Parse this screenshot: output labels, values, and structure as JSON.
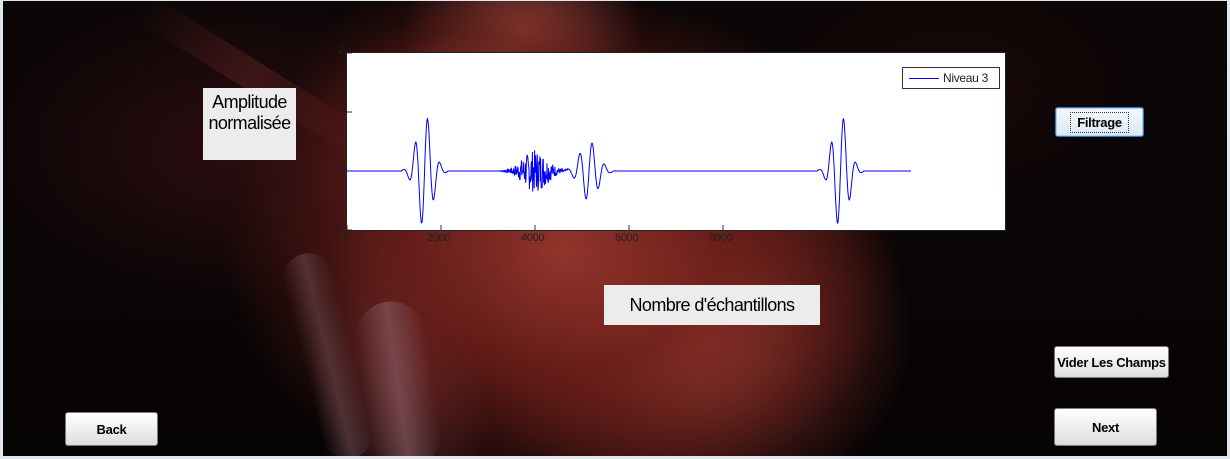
{
  "buttons": {
    "filtrage": "Filtrage",
    "vider": "Vider Les Champs",
    "next": "Next",
    "back": "Back"
  },
  "labels": {
    "ylabel_line1": "Amplitude",
    "ylabel_line2": "normalisée",
    "xlabel": "Nombre d'échantillons"
  },
  "chart_data": {
    "type": "line",
    "xlabel": "Nombre d'échantillons",
    "ylabel": "Amplitude normalisée",
    "xlim": [
      0,
      14000
    ],
    "ylim": [
      -1,
      2
    ],
    "xticks": [
      0,
      2000,
      4000,
      6000,
      8000
    ],
    "yticks": [
      -1,
      0,
      1,
      2
    ],
    "legend_position": "top-right",
    "series": [
      {
        "name": "Niveau 3",
        "color": "#0000ff",
        "x_range": [
          0,
          12000
        ],
        "bursts": [
          {
            "center": 1650,
            "width": 700,
            "amplitude": 0.95,
            "kind": "oscillation"
          },
          {
            "center": 4000,
            "width": 1100,
            "amplitude": 0.3,
            "kind": "noise"
          },
          {
            "center": 5150,
            "width": 800,
            "amplitude": 0.5,
            "kind": "oscillation"
          },
          {
            "center": 10500,
            "width": 700,
            "amplitude": 0.95,
            "kind": "oscillation"
          }
        ]
      }
    ]
  }
}
